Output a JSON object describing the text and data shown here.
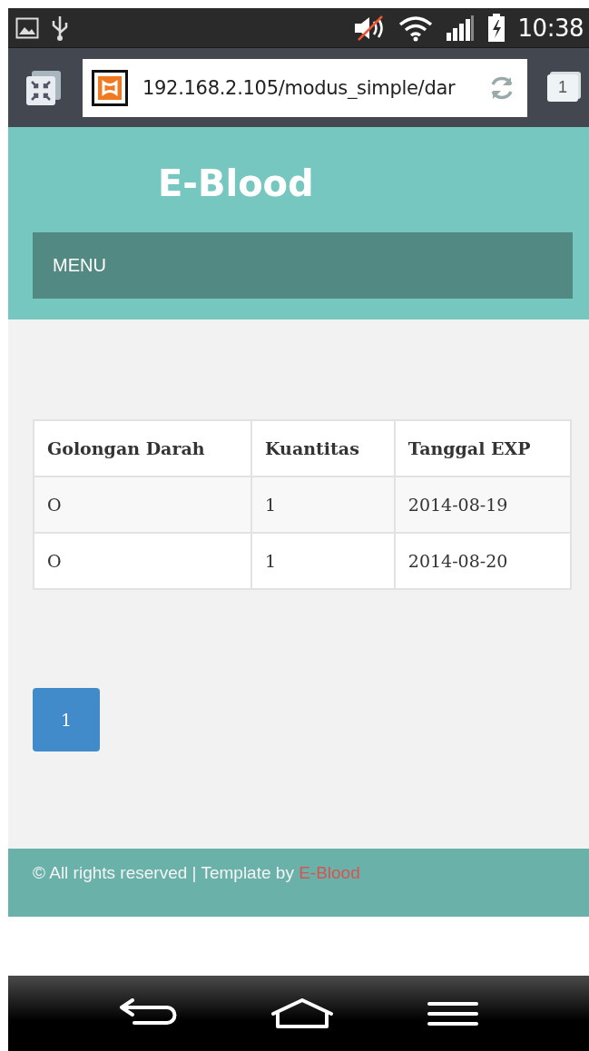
{
  "status_bar": {
    "time": "10:38"
  },
  "browser": {
    "url": "192.168.2.105/modus_simple/dar",
    "tab_count": "1"
  },
  "site": {
    "title": "E-Blood",
    "menu": "MENU"
  },
  "table": {
    "columns": [
      "Golongan Darah",
      "Kuantitas",
      "Tanggal EXP"
    ],
    "rows": [
      [
        "O",
        "1",
        "2014-08-19"
      ],
      [
        "O",
        "1",
        "2014-08-20"
      ]
    ]
  },
  "pagination": [
    {
      "label": "1",
      "selected": true
    }
  ],
  "footer": {
    "text": "© All rights reserved | Template by ",
    "link": "E-Blood"
  }
}
